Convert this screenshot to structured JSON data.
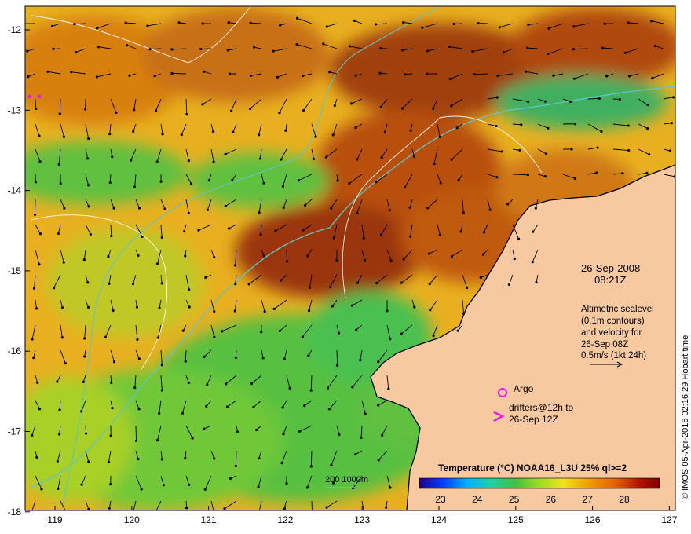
{
  "map": {
    "lat_ticks": [
      "-12",
      "-13",
      "-14",
      "-15",
      "-16",
      "-17",
      "-18"
    ],
    "lon_ticks": [
      "119",
      "120",
      "121",
      "122",
      "123",
      "124",
      "125",
      "126",
      "127"
    ],
    "date": "26-Sep-2008",
    "time": "08:21Z",
    "altimetry_lines": [
      "Altimetric sealevel",
      "(0.1m contours)",
      "and velocity for",
      "26-Sep 08Z",
      "0.5m/s (1kt 24h)"
    ],
    "argo_label": "Argo",
    "drifters_lines": [
      "drifters@12h to",
      "26-Sep 12Z"
    ],
    "depth_label": "200  1000m",
    "colorbar_title": "Temperature (°C) NOAA16_L3U 25% ql>=2",
    "colorbar_ticks": [
      "23",
      "24",
      "25",
      "26",
      "27",
      "28"
    ],
    "credit": "© IMOS 05-Apr-2015 02:16:29 Hobart time",
    "colors": {
      "land": "#f7c9a1",
      "argo": "#e61ee6",
      "depth_contour": "#5fc6c4",
      "colorbar": [
        "#20008a",
        "#0040ff",
        "#00b0ff",
        "#20d0a0",
        "#40c040",
        "#a0dc20",
        "#f0e020",
        "#f0a000",
        "#e06000",
        "#b01000",
        "#800000"
      ]
    }
  }
}
